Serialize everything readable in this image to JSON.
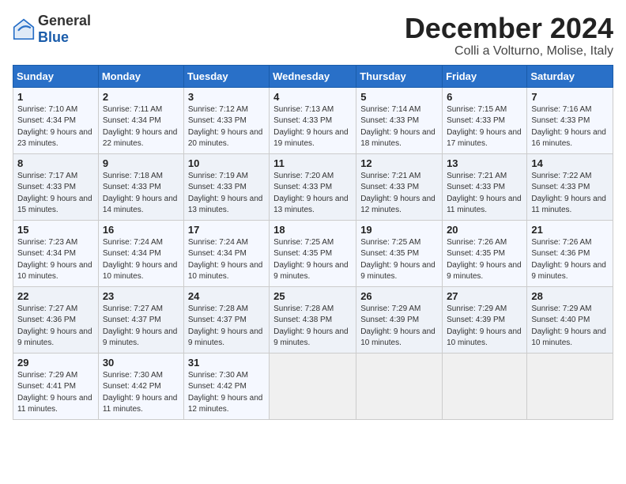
{
  "logo": {
    "general": "General",
    "blue": "Blue"
  },
  "title": "December 2024",
  "location": "Colli a Volturno, Molise, Italy",
  "weekdays": [
    "Sunday",
    "Monday",
    "Tuesday",
    "Wednesday",
    "Thursday",
    "Friday",
    "Saturday"
  ],
  "weeks": [
    [
      {
        "day": "1",
        "sunrise": "Sunrise: 7:10 AM",
        "sunset": "Sunset: 4:34 PM",
        "daylight": "Daylight: 9 hours and 23 minutes."
      },
      {
        "day": "2",
        "sunrise": "Sunrise: 7:11 AM",
        "sunset": "Sunset: 4:34 PM",
        "daylight": "Daylight: 9 hours and 22 minutes."
      },
      {
        "day": "3",
        "sunrise": "Sunrise: 7:12 AM",
        "sunset": "Sunset: 4:33 PM",
        "daylight": "Daylight: 9 hours and 20 minutes."
      },
      {
        "day": "4",
        "sunrise": "Sunrise: 7:13 AM",
        "sunset": "Sunset: 4:33 PM",
        "daylight": "Daylight: 9 hours and 19 minutes."
      },
      {
        "day": "5",
        "sunrise": "Sunrise: 7:14 AM",
        "sunset": "Sunset: 4:33 PM",
        "daylight": "Daylight: 9 hours and 18 minutes."
      },
      {
        "day": "6",
        "sunrise": "Sunrise: 7:15 AM",
        "sunset": "Sunset: 4:33 PM",
        "daylight": "Daylight: 9 hours and 17 minutes."
      },
      {
        "day": "7",
        "sunrise": "Sunrise: 7:16 AM",
        "sunset": "Sunset: 4:33 PM",
        "daylight": "Daylight: 9 hours and 16 minutes."
      }
    ],
    [
      {
        "day": "8",
        "sunrise": "Sunrise: 7:17 AM",
        "sunset": "Sunset: 4:33 PM",
        "daylight": "Daylight: 9 hours and 15 minutes."
      },
      {
        "day": "9",
        "sunrise": "Sunrise: 7:18 AM",
        "sunset": "Sunset: 4:33 PM",
        "daylight": "Daylight: 9 hours and 14 minutes."
      },
      {
        "day": "10",
        "sunrise": "Sunrise: 7:19 AM",
        "sunset": "Sunset: 4:33 PM",
        "daylight": "Daylight: 9 hours and 13 minutes."
      },
      {
        "day": "11",
        "sunrise": "Sunrise: 7:20 AM",
        "sunset": "Sunset: 4:33 PM",
        "daylight": "Daylight: 9 hours and 13 minutes."
      },
      {
        "day": "12",
        "sunrise": "Sunrise: 7:21 AM",
        "sunset": "Sunset: 4:33 PM",
        "daylight": "Daylight: 9 hours and 12 minutes."
      },
      {
        "day": "13",
        "sunrise": "Sunrise: 7:21 AM",
        "sunset": "Sunset: 4:33 PM",
        "daylight": "Daylight: 9 hours and 11 minutes."
      },
      {
        "day": "14",
        "sunrise": "Sunrise: 7:22 AM",
        "sunset": "Sunset: 4:33 PM",
        "daylight": "Daylight: 9 hours and 11 minutes."
      }
    ],
    [
      {
        "day": "15",
        "sunrise": "Sunrise: 7:23 AM",
        "sunset": "Sunset: 4:34 PM",
        "daylight": "Daylight: 9 hours and 10 minutes."
      },
      {
        "day": "16",
        "sunrise": "Sunrise: 7:24 AM",
        "sunset": "Sunset: 4:34 PM",
        "daylight": "Daylight: 9 hours and 10 minutes."
      },
      {
        "day": "17",
        "sunrise": "Sunrise: 7:24 AM",
        "sunset": "Sunset: 4:34 PM",
        "daylight": "Daylight: 9 hours and 10 minutes."
      },
      {
        "day": "18",
        "sunrise": "Sunrise: 7:25 AM",
        "sunset": "Sunset: 4:35 PM",
        "daylight": "Daylight: 9 hours and 9 minutes."
      },
      {
        "day": "19",
        "sunrise": "Sunrise: 7:25 AM",
        "sunset": "Sunset: 4:35 PM",
        "daylight": "Daylight: 9 hours and 9 minutes."
      },
      {
        "day": "20",
        "sunrise": "Sunrise: 7:26 AM",
        "sunset": "Sunset: 4:35 PM",
        "daylight": "Daylight: 9 hours and 9 minutes."
      },
      {
        "day": "21",
        "sunrise": "Sunrise: 7:26 AM",
        "sunset": "Sunset: 4:36 PM",
        "daylight": "Daylight: 9 hours and 9 minutes."
      }
    ],
    [
      {
        "day": "22",
        "sunrise": "Sunrise: 7:27 AM",
        "sunset": "Sunset: 4:36 PM",
        "daylight": "Daylight: 9 hours and 9 minutes."
      },
      {
        "day": "23",
        "sunrise": "Sunrise: 7:27 AM",
        "sunset": "Sunset: 4:37 PM",
        "daylight": "Daylight: 9 hours and 9 minutes."
      },
      {
        "day": "24",
        "sunrise": "Sunrise: 7:28 AM",
        "sunset": "Sunset: 4:37 PM",
        "daylight": "Daylight: 9 hours and 9 minutes."
      },
      {
        "day": "25",
        "sunrise": "Sunrise: 7:28 AM",
        "sunset": "Sunset: 4:38 PM",
        "daylight": "Daylight: 9 hours and 9 minutes."
      },
      {
        "day": "26",
        "sunrise": "Sunrise: 7:29 AM",
        "sunset": "Sunset: 4:39 PM",
        "daylight": "Daylight: 9 hours and 10 minutes."
      },
      {
        "day": "27",
        "sunrise": "Sunrise: 7:29 AM",
        "sunset": "Sunset: 4:39 PM",
        "daylight": "Daylight: 9 hours and 10 minutes."
      },
      {
        "day": "28",
        "sunrise": "Sunrise: 7:29 AM",
        "sunset": "Sunset: 4:40 PM",
        "daylight": "Daylight: 9 hours and 10 minutes."
      }
    ],
    [
      {
        "day": "29",
        "sunrise": "Sunrise: 7:29 AM",
        "sunset": "Sunset: 4:41 PM",
        "daylight": "Daylight: 9 hours and 11 minutes."
      },
      {
        "day": "30",
        "sunrise": "Sunrise: 7:30 AM",
        "sunset": "Sunset: 4:42 PM",
        "daylight": "Daylight: 9 hours and 11 minutes."
      },
      {
        "day": "31",
        "sunrise": "Sunrise: 7:30 AM",
        "sunset": "Sunset: 4:42 PM",
        "daylight": "Daylight: 9 hours and 12 minutes."
      },
      null,
      null,
      null,
      null
    ]
  ]
}
